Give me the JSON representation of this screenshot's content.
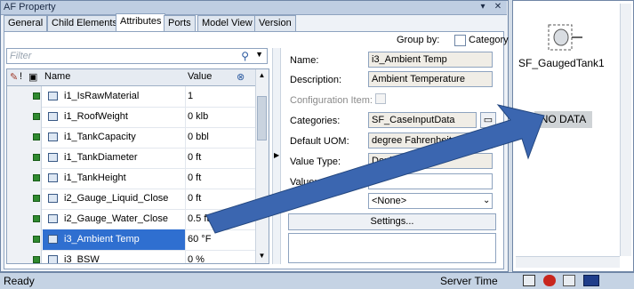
{
  "window": {
    "title": "AF Property"
  },
  "tabs": [
    "General",
    "Child Elements",
    "Attributes",
    "Ports",
    "Model View",
    "Version"
  ],
  "filter": {
    "placeholder": "Filter"
  },
  "grid": {
    "headers": {
      "name": "Name",
      "value": "Value"
    },
    "rows": [
      {
        "name": "i1_IsRawMaterial",
        "value": "1"
      },
      {
        "name": "i1_RoofWeight",
        "value": "0 klb"
      },
      {
        "name": "i1_TankCapacity",
        "value": "0 bbl"
      },
      {
        "name": "i1_TankDiameter",
        "value": "0 ft"
      },
      {
        "name": "i1_TankHeight",
        "value": "0 ft"
      },
      {
        "name": "i2_Gauge_Liquid_Close",
        "value": "0 ft"
      },
      {
        "name": "i2_Gauge_Water_Close",
        "value": "0.5 ft"
      },
      {
        "name": "i3_Ambient Temp",
        "value": "60 °F"
      },
      {
        "name": "i3_BSW",
        "value": "0 %"
      }
    ],
    "selected_index": 7
  },
  "form": {
    "group_by_label": "Group by:",
    "category_label": "Category",
    "name_label": "Name:",
    "name_value": "i3_Ambient Temp",
    "description_label": "Description:",
    "description_value": "Ambient Temperature",
    "config_item_label": "Configuration Item:",
    "categories_label": "Categories:",
    "categories_value": "SF_CaseInputData",
    "default_uom_label": "Default UOM:",
    "default_uom_value": "degree Fahrenheit",
    "value_type_label": "Value Type:",
    "value_type_value": "Double",
    "value_label": "Value:",
    "data_label": "Dat",
    "data_ref_value": "<None>",
    "settings_label": "Settings..."
  },
  "right_panel": {
    "element_name": "SF_GaugedTank1",
    "no_data": "NO DATA"
  },
  "status": {
    "ready": "Ready",
    "server_time": "Server Time"
  },
  "colors": {
    "selection": "#2f6fd0",
    "arrow": "#3b66b0"
  }
}
